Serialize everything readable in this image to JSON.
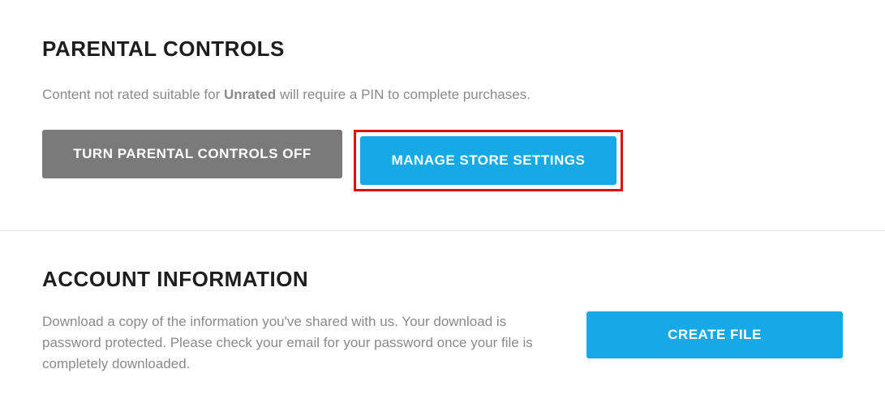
{
  "parental": {
    "heading": "PARENTAL CONTROLS",
    "desc_prefix": "Content not rated suitable for ",
    "desc_bold": "Unrated",
    "desc_suffix": " will require a PIN to complete purchases.",
    "btn_off": "TURN PARENTAL CONTROLS OFF",
    "btn_manage": "MANAGE STORE SETTINGS"
  },
  "account": {
    "heading": "ACCOUNT INFORMATION",
    "desc": "Download a copy of the information you've shared with us. Your download is password protected. Please check your email for your password once your file is completely downloaded.",
    "btn_create": "CREATE FILE"
  }
}
